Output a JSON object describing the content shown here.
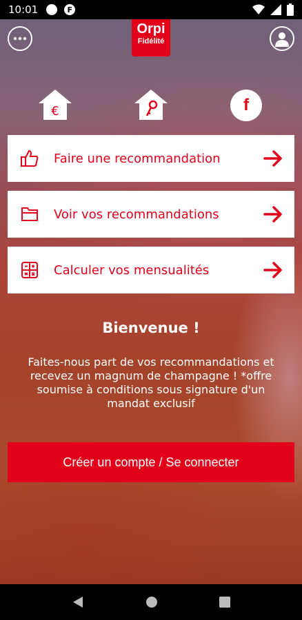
{
  "status_bar": {
    "time": "10:01"
  },
  "logo": {
    "brand": "Orpi",
    "subtitle": "Fidélité"
  },
  "icons": {
    "menu": "more-horizontal-icon",
    "profile": "user-icon",
    "social": [
      "house-euro-icon",
      "house-key-icon",
      "facebook-icon"
    ]
  },
  "actions": [
    {
      "label": "Faire une recommandation",
      "icon": "thumbs-up-icon"
    },
    {
      "label": "Voir vos recommandations",
      "icon": "folder-icon"
    },
    {
      "label": "Calculer vos mensualités",
      "icon": "calculator-icon"
    }
  ],
  "welcome": {
    "title": "Bienvenue !",
    "body": "Faites-nous part de vos recommandations et recevez un magnum de champagne ! *offre soumise à conditions sous signature d'un mandat exclusif"
  },
  "cta": {
    "label": "Créer un compte / Se connecter"
  },
  "colors": {
    "accent": "#e2001a",
    "bar": "#000000",
    "card": "#ffffff"
  }
}
